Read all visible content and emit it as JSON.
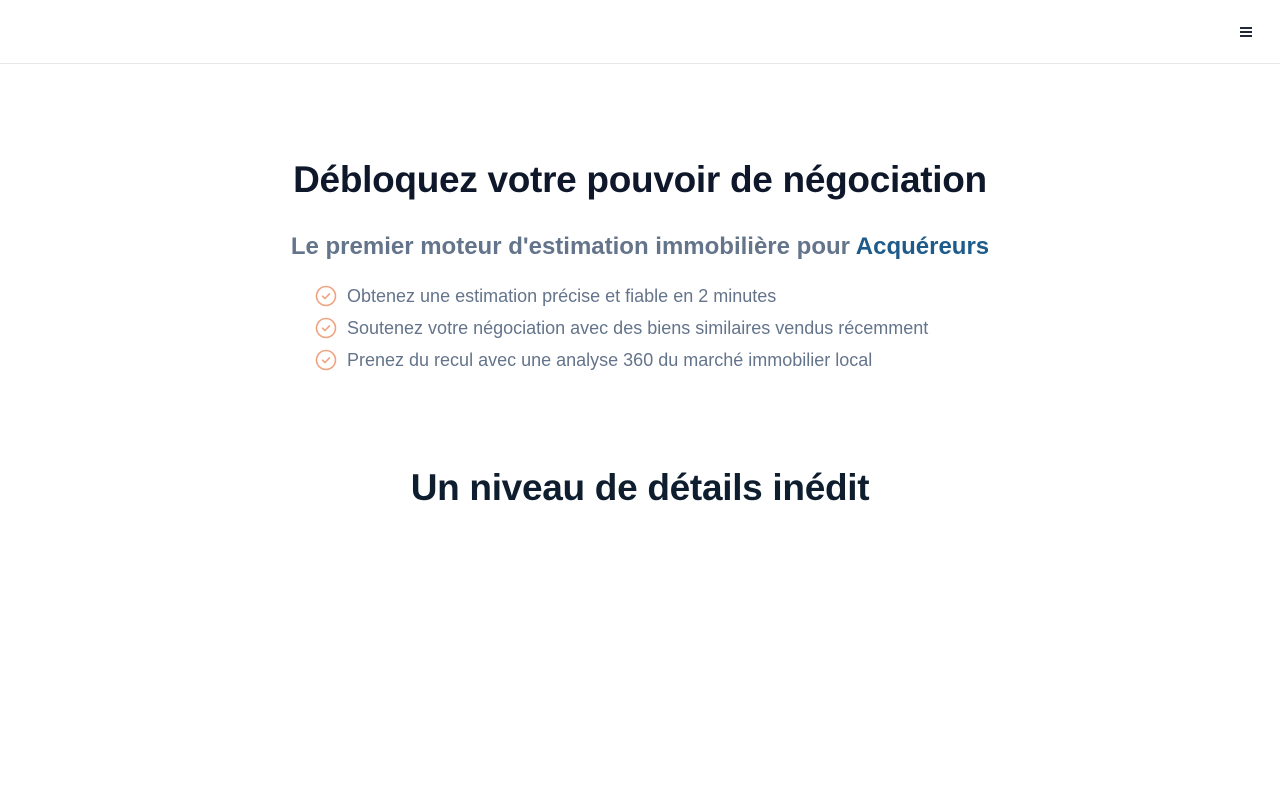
{
  "header": {
    "menu_icon": "hamburger-menu-icon"
  },
  "hero": {
    "title": "Débloquez votre pouvoir de négociation",
    "subtitle_prefix": "Le premier moteur d'estimation immobilière pour ",
    "subtitle_accent": "Acquéreurs",
    "features": [
      {
        "icon": "check-circle-icon",
        "text": "Obtenez une estimation précise et fiable en 2 minutes"
      },
      {
        "icon": "check-circle-icon",
        "text": "Soutenez votre négociation avec des biens similaires vendus récemment"
      },
      {
        "icon": "check-circle-icon",
        "text": "Prenez du recul avec une analyse 360 du marché immobilier local"
      }
    ]
  },
  "details_section": {
    "title": "Un niveau de détails inédit"
  },
  "colors": {
    "title": "#0f172a",
    "muted": "#64748b",
    "accent": "#1e5b8a",
    "check": "#f0a37f"
  }
}
